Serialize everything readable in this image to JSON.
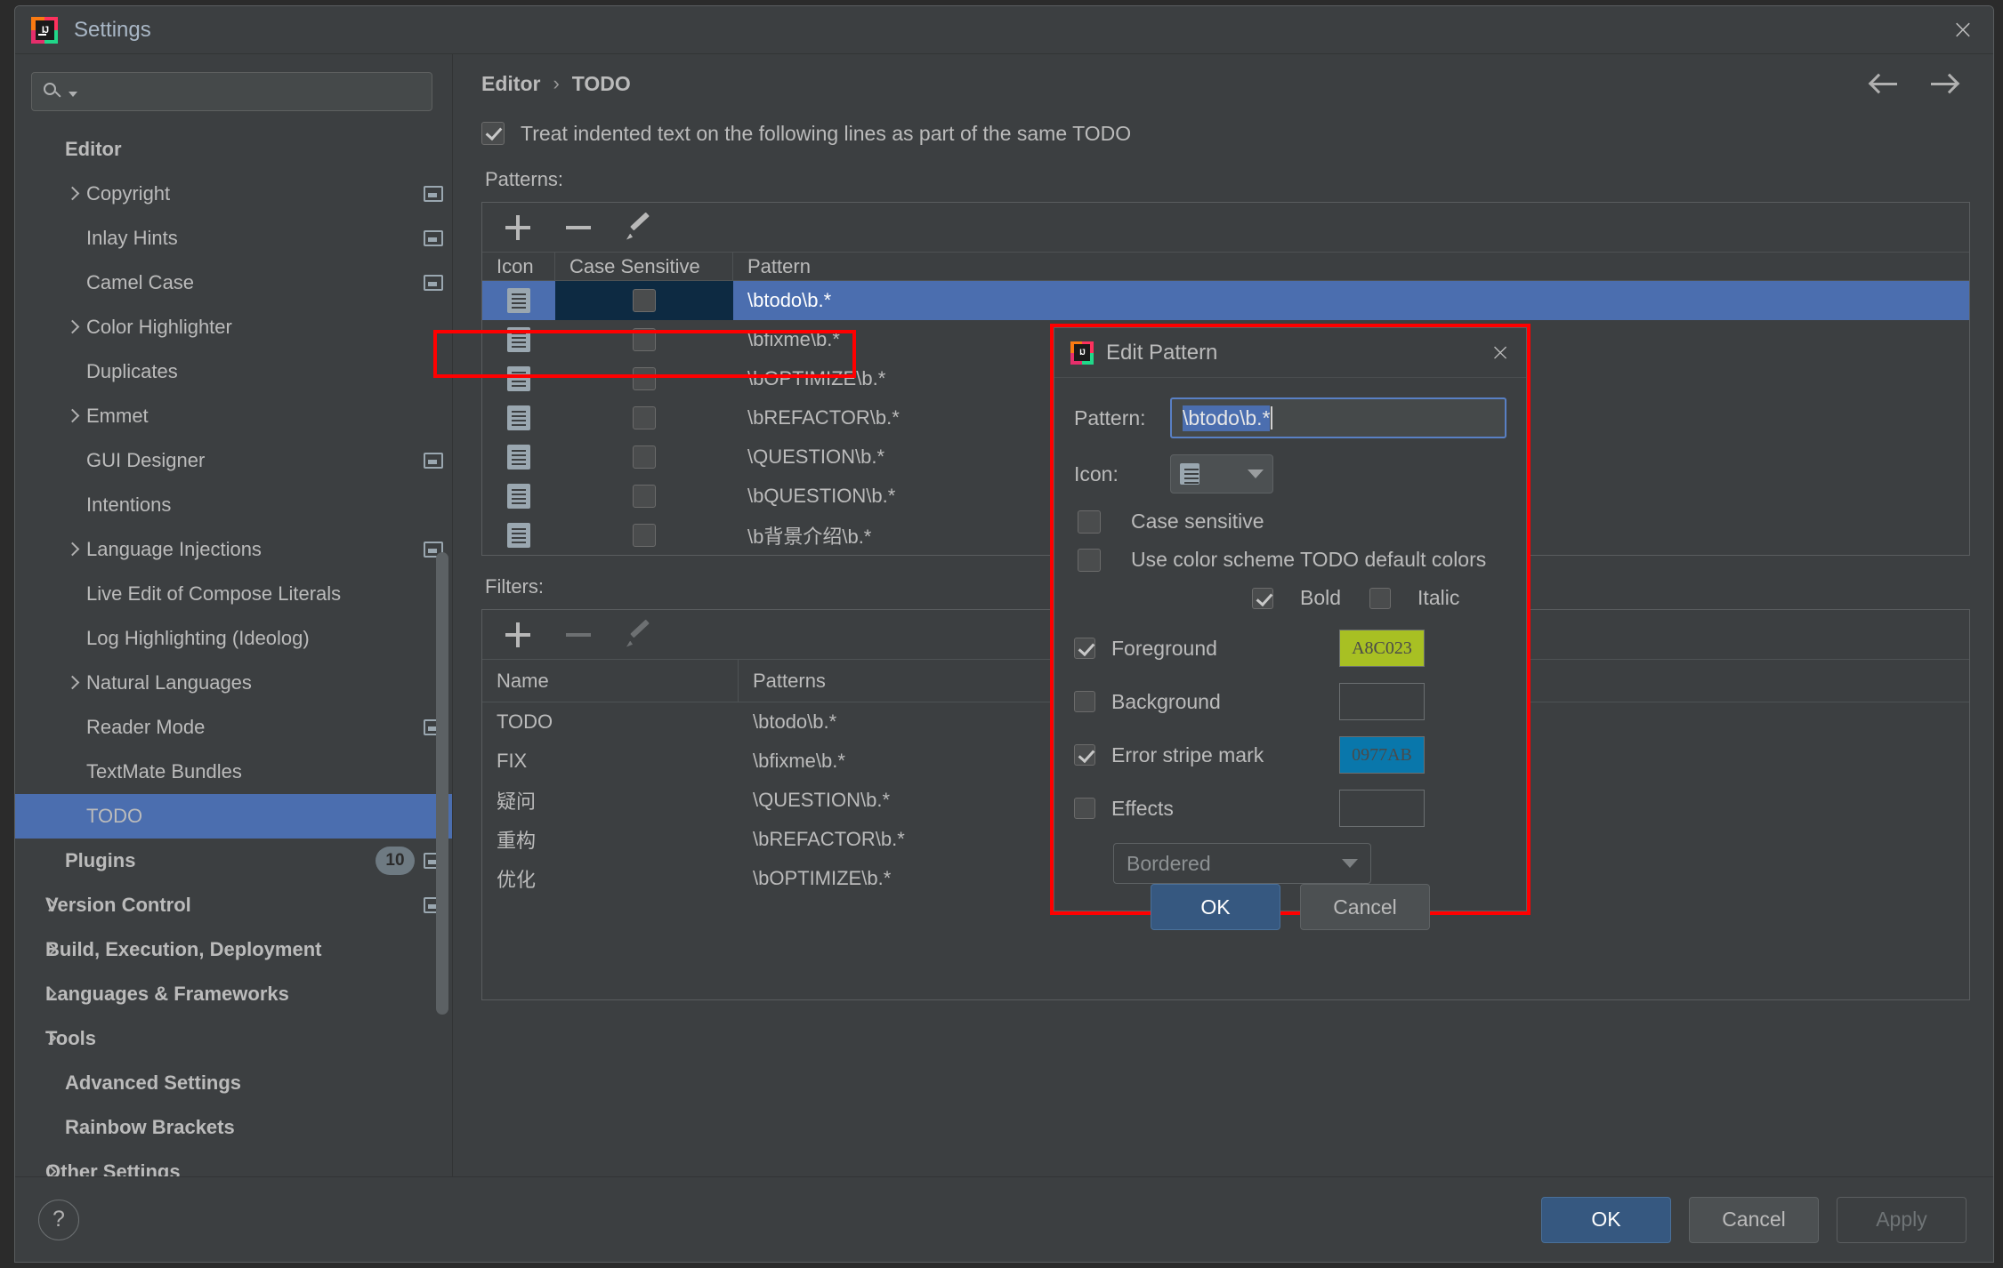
{
  "window": {
    "title": "Settings",
    "logo_text": "IJ",
    "close_icon": "×"
  },
  "sidebar": {
    "search": {
      "placeholder": "",
      "value": ""
    },
    "items": [
      {
        "label": "Editor",
        "level": "root",
        "arrow": false,
        "trail": false,
        "selected": false
      },
      {
        "label": "Copyright",
        "level": "child",
        "arrow": true,
        "trail": true,
        "selected": false
      },
      {
        "label": "Inlay Hints",
        "level": "child",
        "arrow": false,
        "trail": true,
        "selected": false
      },
      {
        "label": "Camel Case",
        "level": "child",
        "arrow": false,
        "trail": true,
        "selected": false
      },
      {
        "label": "Color Highlighter",
        "level": "child",
        "arrow": true,
        "trail": false,
        "selected": false
      },
      {
        "label": "Duplicates",
        "level": "child",
        "arrow": false,
        "trail": false,
        "selected": false
      },
      {
        "label": "Emmet",
        "level": "child",
        "arrow": true,
        "trail": false,
        "selected": false
      },
      {
        "label": "GUI Designer",
        "level": "child",
        "arrow": false,
        "trail": true,
        "selected": false
      },
      {
        "label": "Intentions",
        "level": "child",
        "arrow": false,
        "trail": false,
        "selected": false
      },
      {
        "label": "Language Injections",
        "level": "child",
        "arrow": true,
        "trail": true,
        "selected": false
      },
      {
        "label": "Live Edit of Compose Literals",
        "level": "child",
        "arrow": false,
        "trail": false,
        "selected": false
      },
      {
        "label": "Log Highlighting (Ideolog)",
        "level": "child",
        "arrow": false,
        "trail": false,
        "selected": false
      },
      {
        "label": "Natural Languages",
        "level": "child",
        "arrow": true,
        "trail": false,
        "selected": false
      },
      {
        "label": "Reader Mode",
        "level": "child",
        "arrow": false,
        "trail": true,
        "selected": false
      },
      {
        "label": "TextMate Bundles",
        "level": "child",
        "arrow": false,
        "trail": false,
        "selected": false
      },
      {
        "label": "TODO",
        "level": "child",
        "arrow": false,
        "trail": false,
        "selected": true
      },
      {
        "label": "Plugins",
        "level": "root",
        "arrow": false,
        "trail": true,
        "selected": false,
        "badge": "10"
      },
      {
        "label": "Version Control",
        "level": "group",
        "arrow": true,
        "trail": true,
        "selected": false
      },
      {
        "label": "Build, Execution, Deployment",
        "level": "group",
        "arrow": true,
        "trail": false,
        "selected": false
      },
      {
        "label": "Languages & Frameworks",
        "level": "group",
        "arrow": true,
        "trail": false,
        "selected": false
      },
      {
        "label": "Tools",
        "level": "group",
        "arrow": true,
        "trail": false,
        "selected": false
      },
      {
        "label": "Advanced Settings",
        "level": "root",
        "arrow": false,
        "trail": false,
        "selected": false
      },
      {
        "label": "Rainbow Brackets",
        "level": "root",
        "arrow": false,
        "trail": false,
        "selected": false
      },
      {
        "label": "Other Settings",
        "level": "group",
        "arrow": true,
        "trail": false,
        "selected": false
      }
    ]
  },
  "breadcrumb": {
    "parent": "Editor",
    "separator": "›",
    "current": "TODO"
  },
  "main": {
    "treat_indented_label": "Treat indented text on the following lines as part of the same TODO",
    "treat_indented_checked": true,
    "patterns_label": "Patterns:",
    "filters_label": "Filters:",
    "patterns_columns": [
      "Icon",
      "Case Sensitive",
      "Pattern"
    ],
    "patterns_rows": [
      {
        "icon": "document-icon",
        "case_sensitive": false,
        "pattern": "\\btodo\\b.*",
        "selected": true
      },
      {
        "icon": "document-icon",
        "case_sensitive": false,
        "pattern": "\\bfixme\\b.*",
        "selected": false
      },
      {
        "icon": "document-icon",
        "case_sensitive": false,
        "pattern": "\\bOPTIMIZE\\b.*",
        "selected": false
      },
      {
        "icon": "document-icon",
        "case_sensitive": false,
        "pattern": "\\bREFACTOR\\b.*",
        "selected": false
      },
      {
        "icon": "document-icon",
        "case_sensitive": false,
        "pattern": "\\QUESTION\\b.*",
        "selected": false
      },
      {
        "icon": "document-icon",
        "case_sensitive": false,
        "pattern": "\\bQUESTION\\b.*",
        "selected": false
      },
      {
        "icon": "document-icon",
        "case_sensitive": false,
        "pattern": "\\b背景介绍\\b.*",
        "selected": false
      }
    ],
    "filters_columns": [
      "Name",
      "Patterns"
    ],
    "filters_rows": [
      {
        "name": "TODO",
        "patterns": "\\btodo\\b.*"
      },
      {
        "name": "FIX",
        "patterns": "\\bfixme\\b.*"
      },
      {
        "name": "疑问",
        "patterns": "\\QUESTION\\b.*"
      },
      {
        "name": "重构",
        "patterns": "\\bREFACTOR\\b.*"
      },
      {
        "name": "优化",
        "patterns": "\\bOPTIMIZE\\b.*"
      }
    ]
  },
  "dialog": {
    "title": "Edit Pattern",
    "close_icon": "×",
    "pattern_label": "Pattern:",
    "pattern_value": "\\btodo\\b.*",
    "icon_label": "Icon:",
    "icon_value": "document-icon",
    "case_sensitive_label": "Case sensitive",
    "case_sensitive_checked": false,
    "use_default_colors_label": "Use color scheme TODO default colors",
    "use_default_colors_checked": false,
    "bold_label": "Bold",
    "bold_checked": true,
    "italic_label": "Italic",
    "italic_checked": false,
    "foreground_label": "Foreground",
    "foreground_checked": true,
    "foreground_color": "A8C023",
    "background_label": "Background",
    "background_checked": false,
    "background_color": "",
    "error_stripe_label": "Error stripe mark",
    "error_stripe_checked": true,
    "error_stripe_color": "0977AB",
    "effects_label": "Effects",
    "effects_checked": false,
    "effects_color": "",
    "effects_style": "Bordered",
    "ok_label": "OK",
    "cancel_label": "Cancel"
  },
  "footer": {
    "help_icon": "?",
    "ok_label": "OK",
    "cancel_label": "Cancel",
    "apply_label": "Apply"
  },
  "colors": {
    "accent": "#4b6eaf",
    "primary_button": "#365880",
    "highlight_box": "#ff0000",
    "foreground_swatch": "#A8C023",
    "error_stripe_swatch": "#0977AB"
  }
}
